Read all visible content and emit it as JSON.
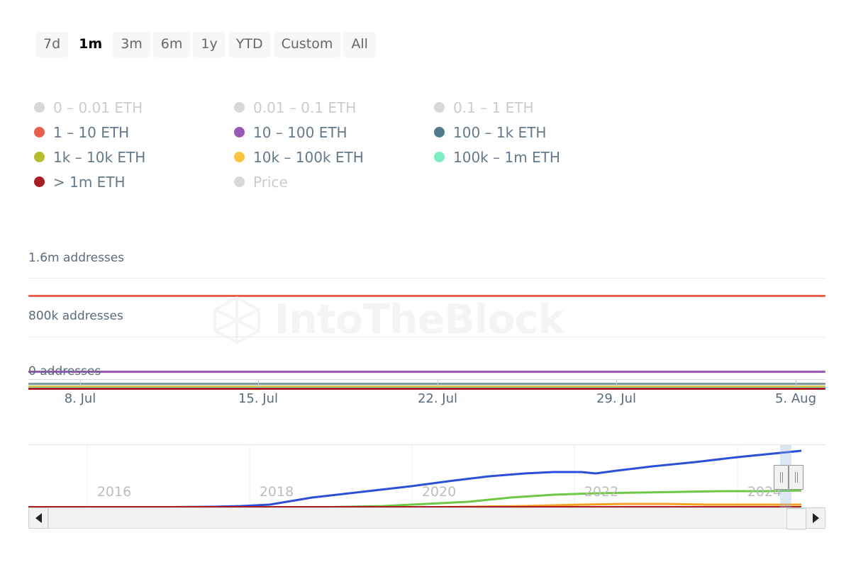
{
  "range_selector": {
    "buttons": [
      {
        "label": "7d",
        "selected": false
      },
      {
        "label": "1m",
        "selected": true
      },
      {
        "label": "3m",
        "selected": false
      },
      {
        "label": "6m",
        "selected": false
      },
      {
        "label": "1y",
        "selected": false
      },
      {
        "label": "YTD",
        "selected": false
      },
      {
        "label": "Custom",
        "selected": false
      },
      {
        "label": "All",
        "selected": false
      }
    ]
  },
  "legend": {
    "items": [
      {
        "label": "0 – 0.01 ETH",
        "color": "#d8d8d8",
        "disabled": true
      },
      {
        "label": "0.01 – 0.1 ETH",
        "color": "#d8d8d8",
        "disabled": true
      },
      {
        "label": "0.1 – 1 ETH",
        "color": "#d8d8d8",
        "disabled": true
      },
      {
        "label": "1 – 10 ETH",
        "color": "#e8604c",
        "disabled": false
      },
      {
        "label": "10 – 100 ETH",
        "color": "#9b59b6",
        "disabled": false
      },
      {
        "label": "100 – 1k ETH",
        "color": "#4e7b8c",
        "disabled": false
      },
      {
        "label": "1k – 10k ETH",
        "color": "#b5bd2e",
        "disabled": false
      },
      {
        "label": "10k – 100k ETH",
        "color": "#fbc541",
        "disabled": false
      },
      {
        "label": "100k – 1m ETH",
        "color": "#7eecc0",
        "disabled": false
      },
      {
        "label": "> 1m ETH",
        "color": "#a81e24",
        "disabled": false
      },
      {
        "label": "Price",
        "color": "#d8d8d8",
        "disabled": true
      }
    ]
  },
  "watermark": {
    "text": "IntoTheBlock",
    "logo_icon": "hexagon-logo-icon"
  },
  "chart_data": {
    "type": "line",
    "title": "",
    "xlabel": "",
    "ylabel": "addresses",
    "ytick_labels": [
      "1.6m addresses",
      "800k addresses",
      "0 addresses"
    ],
    "ytick_values": [
      1600000,
      800000,
      0
    ],
    "ylim": [
      0,
      1800000
    ],
    "x": [
      "8. Jul",
      "15. Jul",
      "22. Jul",
      "29. Jul",
      "5. Aug"
    ],
    "xtick_labels": [
      "8. Jul",
      "15. Jul",
      "22. Jul",
      "29. Jul",
      "5. Aug"
    ],
    "grid": true,
    "legend_position": "top-left",
    "series": [
      {
        "name": "1 – 10 ETH",
        "color": "#e8604c",
        "values": [
          1480000,
          1480000,
          1482000,
          1484000,
          1486000
        ],
        "visible": true
      },
      {
        "name": "10 – 100 ETH",
        "color": "#9b59b6",
        "values": [
          245000,
          245000,
          246000,
          247000,
          248000
        ],
        "visible": true
      },
      {
        "name": "100 – 1k ETH",
        "color": "#4e7b8c",
        "values": [
          52000,
          52000,
          52000,
          52500,
          52500
        ],
        "visible": true
      },
      {
        "name": "1k – 10k ETH",
        "color": "#b5bd2e",
        "values": [
          36000,
          36000,
          36000,
          36000,
          36000
        ],
        "visible": true
      },
      {
        "name": "10k – 100k ETH",
        "color": "#fbc541",
        "values": [
          28000,
          28000,
          28000,
          28000,
          28000
        ],
        "visible": true
      },
      {
        "name": "100k – 1m ETH",
        "color": "#7eecc0",
        "values": [
          18000,
          18000,
          18000,
          18000,
          18000
        ],
        "visible": true
      },
      {
        "name": "> 1m ETH",
        "color": "#a81e24",
        "values": [
          9000,
          9000,
          9000,
          9000,
          9000
        ],
        "visible": true
      },
      {
        "name": "0 – 0.01 ETH",
        "color": "#d8d8d8",
        "values": [
          0,
          0,
          0,
          0,
          0
        ],
        "visible": false
      },
      {
        "name": "0.01 – 0.1 ETH",
        "color": "#d8d8d8",
        "values": [
          0,
          0,
          0,
          0,
          0
        ],
        "visible": false
      },
      {
        "name": "0.1 – 1 ETH",
        "color": "#d8d8d8",
        "values": [
          0,
          0,
          0,
          0,
          0
        ],
        "visible": false
      },
      {
        "name": "Price",
        "color": "#d8d8d8",
        "values": [
          0,
          0,
          0,
          0,
          0
        ],
        "visible": false
      }
    ]
  },
  "navigator": {
    "year_labels": [
      "2016",
      "2018",
      "2020",
      "2022",
      "2024"
    ],
    "series": [
      {
        "name": "1 – 10 ETH",
        "color": "#2b4fd8"
      },
      {
        "name": "10 – 100 ETH",
        "color": "#6ec845"
      },
      {
        "name": "100 – 1k ETH",
        "color": "#f5a020"
      },
      {
        "name": "> 1m ETH",
        "color": "#a81e24"
      }
    ],
    "left_handle_icon": "grip-handle-icon",
    "right_handle_icon": "grip-handle-icon"
  },
  "scrollbar": {
    "left_button_icon": "arrow-left-icon",
    "right_button_icon": "arrow-right-icon"
  }
}
